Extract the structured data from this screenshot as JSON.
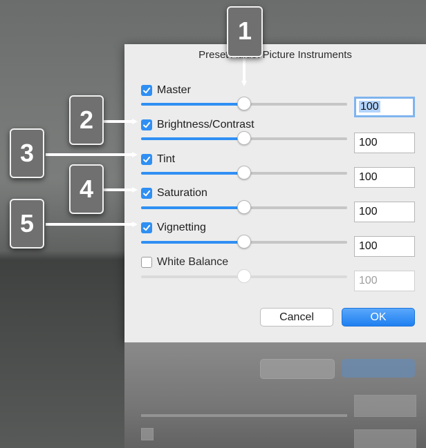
{
  "dialog": {
    "title": "Preset Adjust Picture Instruments",
    "rows": [
      {
        "label": "Master",
        "checked": true,
        "value": "100",
        "slider_fraction": 0.5,
        "focused": true
      },
      {
        "label": "Brightness/Contrast",
        "checked": true,
        "value": "100",
        "slider_fraction": 0.5
      },
      {
        "label": "Tint",
        "checked": true,
        "value": "100",
        "slider_fraction": 0.5
      },
      {
        "label": "Saturation",
        "checked": true,
        "value": "100",
        "slider_fraction": 0.5
      },
      {
        "label": "Vignetting",
        "checked": true,
        "value": "100",
        "slider_fraction": 0.5
      },
      {
        "label": "White Balance",
        "checked": false,
        "value": "100",
        "slider_fraction": 0.5,
        "disabled": true
      }
    ],
    "buttons": {
      "cancel": "Cancel",
      "ok": "OK"
    }
  },
  "callouts": [
    "1",
    "2",
    "3",
    "4",
    "5"
  ],
  "colors": {
    "accent": "#2f8ff3",
    "callout_bg": "#6f706f"
  }
}
